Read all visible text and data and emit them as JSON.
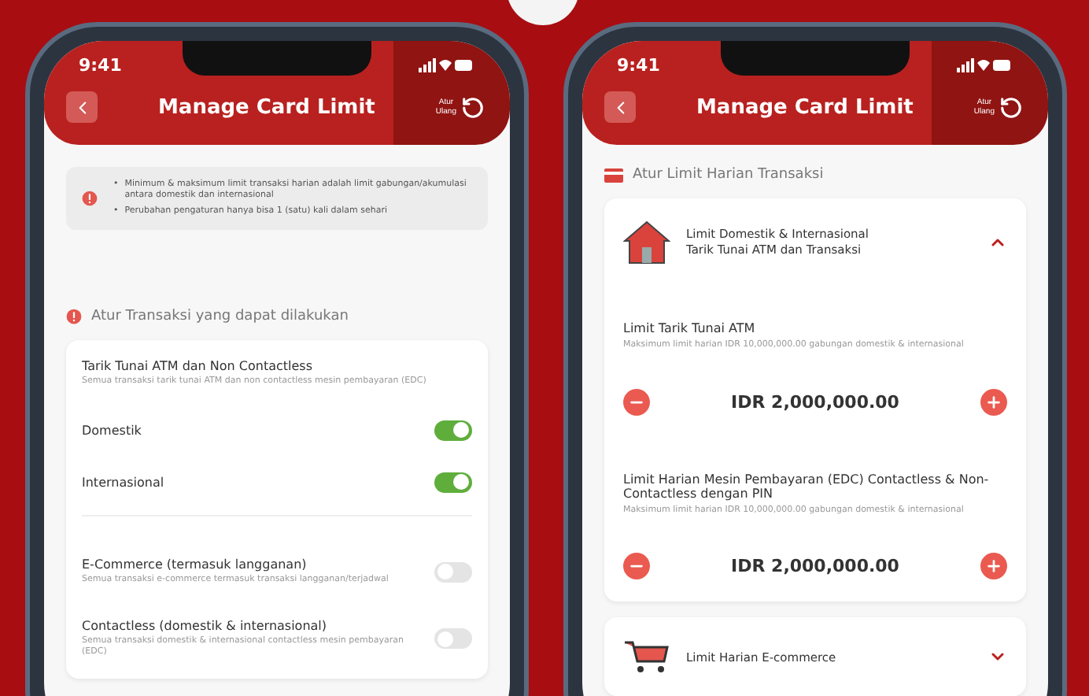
{
  "screens": [
    {
      "kind": "transactions",
      "time": "9:41",
      "title": "Manage Card Limit",
      "reset_label": [
        "Atur",
        "Ulang"
      ],
      "info_notes": [
        {
          "marker": "•",
          "text": "Minimum & maksimum limit transaksi harian adalah limit gabungan/akumulasi antara domestik dan internasional"
        },
        {
          "marker": "•",
          "text": "Perubahan pengaturan hanya bisa 1 (satu) kali dalam sehari"
        }
      ],
      "section_title": "Atur Transaksi yang dapat dilakukan",
      "items": [
        {
          "kind": "group",
          "title": "Tarik Tunai ATM dan Non Contactless",
          "description": "Semua transaksi tarik tunai ATM dan non contactless mesin pembayaran (EDC)",
          "options": [
            {
              "label": "Domestik",
              "on": true
            },
            {
              "label": "Internasional",
              "on": true
            }
          ]
        },
        {
          "kind": "single",
          "title": "E-Commerce (termasuk langganan)",
          "description": "Semua transaksi e-commerce termasuk transaksi langganan/terjadwal",
          "on": false
        },
        {
          "kind": "single",
          "title": "Contactless (domestik & internasional)",
          "description": "Semua transaksi domestik & internasional contactless mesin pembayaran (EDC)",
          "on": false
        }
      ]
    },
    {
      "kind": "limits",
      "time": "9:41",
      "title": "Manage Card Limit",
      "reset_label": [
        "Atur",
        "Ulang"
      ],
      "section_title": "Atur Limit Harian Transaksi",
      "accordions": [
        {
          "kind": "domestic",
          "title_lines": [
            "Limit Domestik & Internasional",
            "Tarik Tunai ATM dan Transaksi"
          ],
          "expanded": true,
          "limits": [
            {
              "title": "Limit Tarik Tunai ATM",
              "description": "Maksimum limit harian IDR 10,000,000.00 gabungan domestik & internasional",
              "value": "IDR 2,000,000.00"
            },
            {
              "title": "Limit Harian Mesin Pembayaran (EDC) Contactless & Non-Contactless dengan PIN",
              "description": "Maksimum limit harian IDR 10,000,000.00 gabungan domestik & internasional",
              "value": "IDR 2,000,000.00"
            }
          ]
        },
        {
          "kind": "ecommerce",
          "title_lines": [
            "Limit Harian E-commerce"
          ],
          "expanded": false
        }
      ]
    }
  ]
}
